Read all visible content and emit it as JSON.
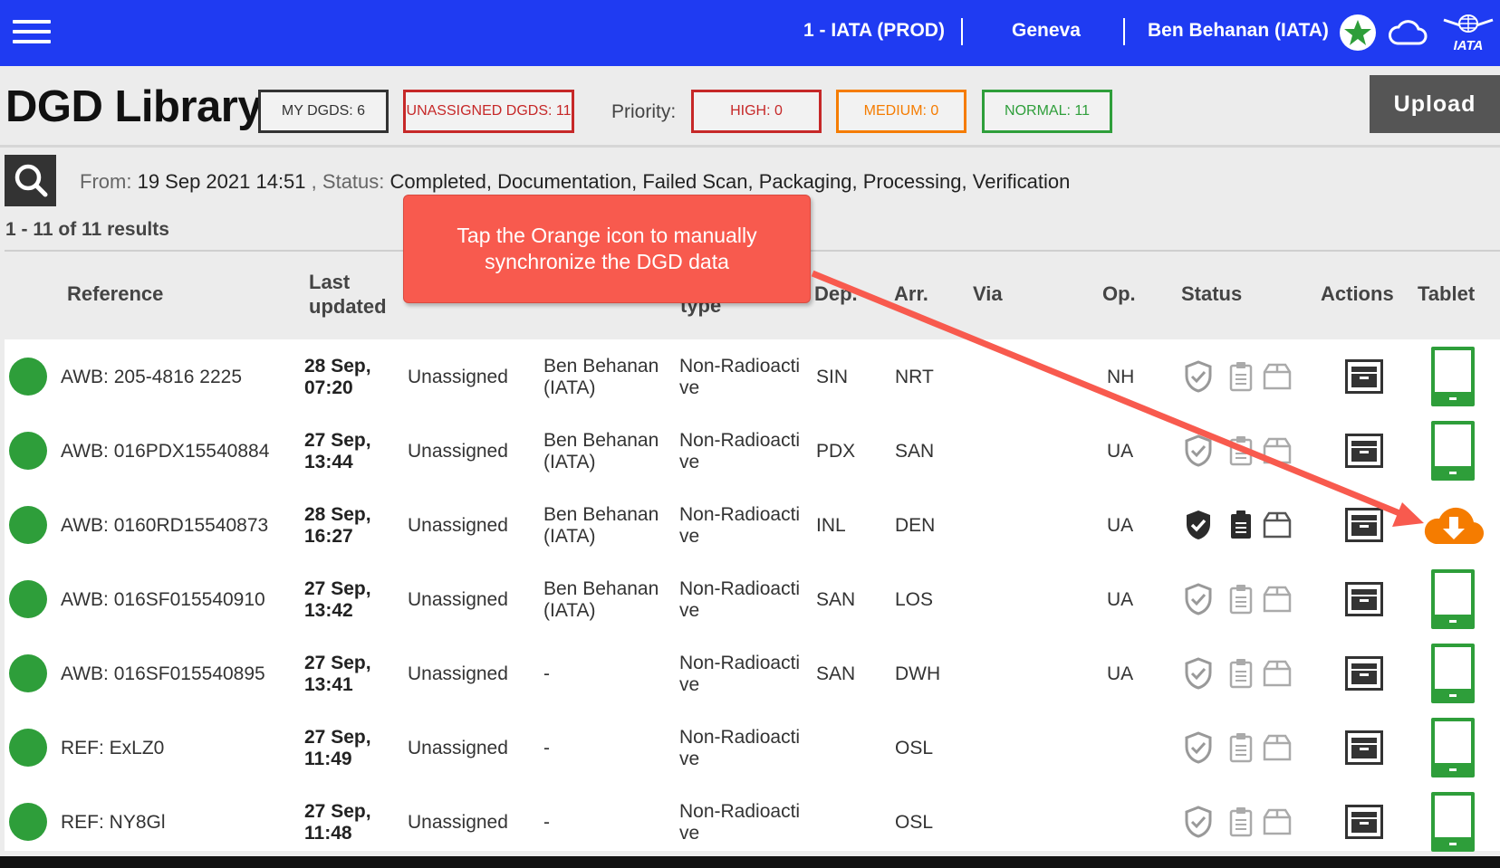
{
  "topbar": {
    "environment": "1 - IATA (PROD)",
    "location": "Geneva",
    "user": "Ben Behanan (IATA)",
    "logo_text": "IATA",
    "color": "#1f3bf2"
  },
  "header": {
    "title": "DGD Library",
    "my_dgds": "MY DGDS: 6",
    "unassigned_dgds": "UNASSIGNED DGDS: 11",
    "priority_label": "Priority:",
    "high": "HIGH: 0",
    "medium": "MEDIUM: 0",
    "normal": "NORMAL: 11",
    "upload": "Upload"
  },
  "filter": {
    "from_label": "From:",
    "from_value": "19 Sep 2021 14:51",
    "sep": ",",
    "status_label": "Status:",
    "status_value": "Completed, Documentation, Failed Scan, Packaging, Processing, Verification",
    "results": "1 - 11 of 11 results"
  },
  "columns": {
    "reference": "Reference",
    "last_updated_1": "Last",
    "last_updated_2": "updated",
    "type_2": "type",
    "dep": "Dep.",
    "arr": "Arr.",
    "via": "Via",
    "op": "Op.",
    "status": "Status",
    "actions": "Actions",
    "tablet": "Tablet"
  },
  "rows": [
    {
      "ref": "AWB: 205-4816 2225",
      "date": "28 Sep,",
      "time": "07:20",
      "assign": "Unassigned",
      "by1": "Ben Behanan",
      "by2": "(IATA)",
      "type1": "Non-Radioacti",
      "type2": "ve",
      "dep": "SIN",
      "arr": "NRT",
      "op": "NH",
      "sync": "tablet"
    },
    {
      "ref": "AWB: 016PDX15540884",
      "date": "27 Sep,",
      "time": "13:44",
      "assign": "Unassigned",
      "by1": "Ben Behanan",
      "by2": "(IATA)",
      "type1": "Non-Radioacti",
      "type2": "ve",
      "dep": "PDX",
      "arr": "SAN",
      "op": "UA",
      "sync": "tablet"
    },
    {
      "ref": "AWB: 0160RD15540873",
      "date": "28 Sep,",
      "time": "16:27",
      "assign": "Unassigned",
      "by1": "Ben Behanan",
      "by2": "(IATA)",
      "type1": "Non-Radioacti",
      "type2": "ve",
      "dep": "INL",
      "arr": "DEN",
      "op": "UA",
      "sync": "cloud-download"
    },
    {
      "ref": "AWB: 016SF015540910",
      "date": "27 Sep,",
      "time": "13:42",
      "assign": "Unassigned",
      "by1": "Ben Behanan",
      "by2": "(IATA)",
      "type1": "Non-Radioacti",
      "type2": "ve",
      "dep": "SAN",
      "arr": "LOS",
      "op": "UA",
      "sync": "tablet"
    },
    {
      "ref": "AWB: 016SF015540895",
      "date": "27 Sep,",
      "time": "13:41",
      "assign": "Unassigned",
      "by1": "-",
      "by2": "",
      "type1": "Non-Radioacti",
      "type2": "ve",
      "dep": "SAN",
      "arr": "DWH",
      "op": "UA",
      "sync": "tablet"
    },
    {
      "ref": "REF: ExLZ0",
      "date": "27 Sep,",
      "time": "11:49",
      "assign": "Unassigned",
      "by1": "-",
      "by2": "",
      "type1": "Non-Radioacti",
      "type2": "ve",
      "dep": "",
      "arr": "OSL",
      "op": "",
      "sync": "tablet"
    },
    {
      "ref": "REF: NY8Gl",
      "date": "27 Sep,",
      "time": "11:48",
      "assign": "Unassigned",
      "by1": "-",
      "by2": "",
      "type1": "Non-Radioacti",
      "type2": "ve",
      "dep": "",
      "arr": "OSL",
      "op": "",
      "sync": "tablet"
    }
  ],
  "callout": {
    "line1": "Tap the Orange icon to manually",
    "line2": "synchronize the DGD data"
  },
  "colors": {
    "green": "#2e9e3a",
    "orange": "#f57c00",
    "red": "#c62828",
    "callout": "#f85a4e"
  }
}
